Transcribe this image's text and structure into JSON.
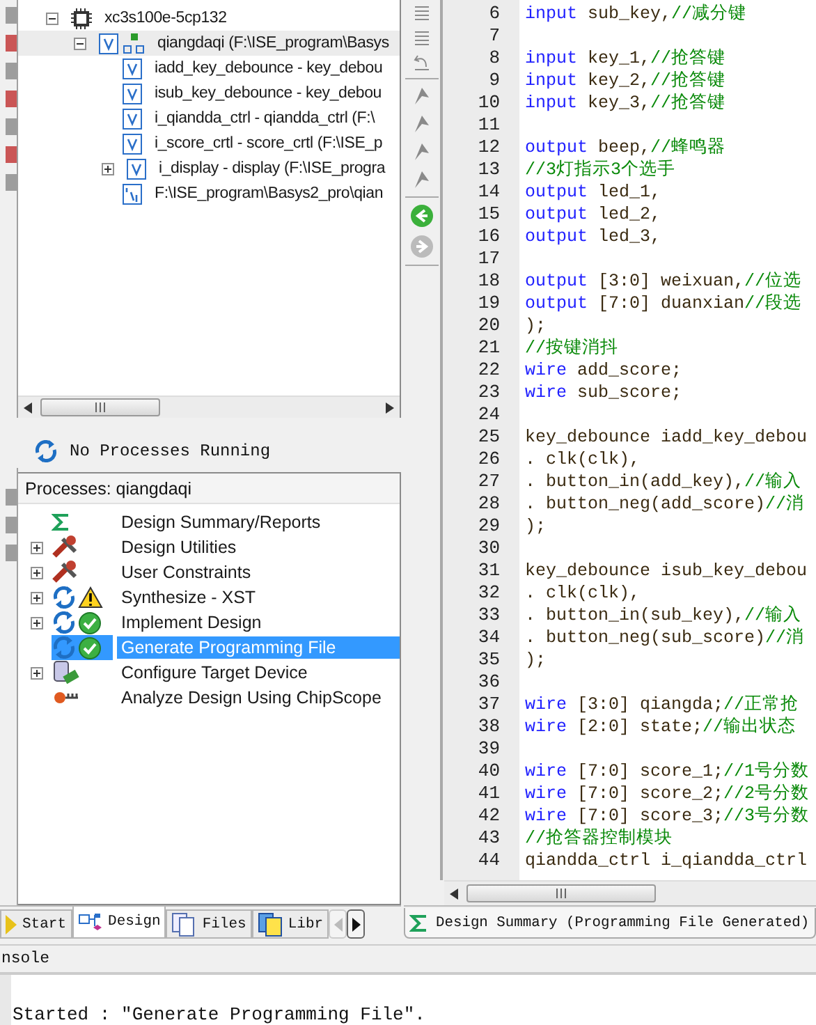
{
  "hierarchy": {
    "items": [
      {
        "label": "xc3s100e-5cp132",
        "kind": "chip",
        "expandable": true,
        "expanded": true,
        "selected": false,
        "children": [
          {
            "label": "qiangdaqi (F:\\ISE_program\\Basys",
            "kind": "top",
            "expandable": true,
            "expanded": true,
            "selected": true,
            "children": [
              {
                "label": "iadd_key_debounce - key_debou",
                "kind": "verilog",
                "expandable": false,
                "selected": false
              },
              {
                "label": "isub_key_debounce - key_debou",
                "kind": "verilog",
                "expandable": false,
                "selected": false
              },
              {
                "label": "i_qiandda_ctrl - qiandda_ctrl (F:\\",
                "kind": "verilog",
                "expandable": false,
                "selected": false
              },
              {
                "label": "i_score_crtl - score_crtl (F:\\ISE_p",
                "kind": "verilog",
                "expandable": false,
                "selected": false
              },
              {
                "label": "i_display - display (F:\\ISE_progra",
                "kind": "verilog",
                "expandable": true,
                "expanded": false,
                "selected": false
              },
              {
                "label": "F:\\ISE_program\\Basys2_pro\\qian",
                "kind": "ucf",
                "expandable": false,
                "selected": false
              }
            ]
          }
        ]
      }
    ]
  },
  "process_status": "No Processes Running",
  "processes": {
    "title": "Processes: qiangdaqi",
    "items": [
      {
        "label": "Design Summary/Reports",
        "kind": "summary",
        "warning": false,
        "completed": false,
        "expandable": false,
        "selected": false
      },
      {
        "label": "Design Utilities",
        "kind": "tools",
        "warning": false,
        "completed": false,
        "expandable": true,
        "selected": false
      },
      {
        "label": "User Constraints",
        "kind": "tools",
        "warning": false,
        "completed": false,
        "expandable": true,
        "selected": false
      },
      {
        "label": "Synthesize - XST",
        "kind": "run",
        "warning": true,
        "completed": false,
        "expandable": true,
        "selected": false
      },
      {
        "label": "Implement Design",
        "kind": "run",
        "warning": false,
        "completed": true,
        "expandable": true,
        "selected": false
      },
      {
        "label": "Generate Programming File",
        "kind": "run",
        "warning": false,
        "completed": true,
        "expandable": false,
        "selected": true
      },
      {
        "label": "Configure Target Device",
        "kind": "device",
        "warning": false,
        "completed": false,
        "expandable": true,
        "selected": false
      },
      {
        "label": "Analyze Design Using ChipScope",
        "kind": "probe",
        "warning": false,
        "completed": false,
        "expandable": false,
        "selected": false
      }
    ]
  },
  "panel_tabs": [
    {
      "label": "Start",
      "kind": "start",
      "selected": false
    },
    {
      "label": "Design",
      "kind": "design",
      "selected": true
    },
    {
      "label": "Files",
      "kind": "files",
      "selected": false
    },
    {
      "label": "Libr",
      "kind": "libraries",
      "selected": false
    }
  ],
  "tab_scroll": [
    {
      "kind": "left",
      "disabled": true
    },
    {
      "kind": "right",
      "disabled": false
    }
  ],
  "editor": {
    "lines": [
      {
        "number": "6",
        "tokens": [
          {
            "kind": "keyword",
            "text": "input"
          },
          {
            "kind": "plain",
            "text": " sub_key,"
          },
          {
            "kind": "comment",
            "text": "//减分键"
          }
        ]
      },
      {
        "number": "7"
      },
      {
        "number": "8",
        "tokens": [
          {
            "kind": "keyword",
            "text": "input"
          },
          {
            "kind": "plain",
            "text": " key_1,"
          },
          {
            "kind": "comment",
            "text": "//抢答键"
          }
        ]
      },
      {
        "number": "9",
        "tokens": [
          {
            "kind": "keyword",
            "text": "input"
          },
          {
            "kind": "plain",
            "text": " key_2,"
          },
          {
            "kind": "comment",
            "text": "//抢答键"
          }
        ]
      },
      {
        "number": "10",
        "tokens": [
          {
            "kind": "keyword",
            "text": "input"
          },
          {
            "kind": "plain",
            "text": " key_3,"
          },
          {
            "kind": "comment",
            "text": "//抢答键"
          }
        ]
      },
      {
        "number": "11"
      },
      {
        "number": "12",
        "tokens": [
          {
            "kind": "keyword",
            "text": "output"
          },
          {
            "kind": "plain",
            "text": " beep,"
          },
          {
            "kind": "comment",
            "text": "//蜂鸣器"
          }
        ]
      },
      {
        "number": "13",
        "tokens": [
          {
            "kind": "comment",
            "text": "//3灯指示3个选手"
          }
        ]
      },
      {
        "number": "14",
        "tokens": [
          {
            "kind": "keyword",
            "text": "output"
          },
          {
            "kind": "plain",
            "text": " led_1,"
          }
        ]
      },
      {
        "number": "15",
        "tokens": [
          {
            "kind": "keyword",
            "text": "output"
          },
          {
            "kind": "plain",
            "text": " led_2,"
          }
        ]
      },
      {
        "number": "16",
        "tokens": [
          {
            "kind": "keyword",
            "text": "output"
          },
          {
            "kind": "plain",
            "text": " led_3,"
          }
        ]
      },
      {
        "number": "17"
      },
      {
        "number": "18",
        "tokens": [
          {
            "kind": "keyword",
            "text": "output"
          },
          {
            "kind": "plain",
            "text": " [3:0] weixuan,"
          },
          {
            "kind": "comment",
            "text": "//位选"
          }
        ]
      },
      {
        "number": "19",
        "tokens": [
          {
            "kind": "keyword",
            "text": "output"
          },
          {
            "kind": "plain",
            "text": " [7:0] duanxian"
          },
          {
            "kind": "comment",
            "text": "//段选"
          }
        ]
      },
      {
        "number": "20",
        "tokens": [
          {
            "kind": "plain",
            "text": ");"
          }
        ]
      },
      {
        "number": "21",
        "tokens": [
          {
            "kind": "comment",
            "text": "//按键消抖"
          }
        ]
      },
      {
        "number": "22",
        "tokens": [
          {
            "kind": "keyword",
            "text": "wire"
          },
          {
            "kind": "plain",
            "text": " add_score;"
          }
        ]
      },
      {
        "number": "23",
        "tokens": [
          {
            "kind": "keyword",
            "text": "wire"
          },
          {
            "kind": "plain",
            "text": " sub_score;"
          }
        ]
      },
      {
        "number": "24"
      },
      {
        "number": "25",
        "tokens": [
          {
            "kind": "plain",
            "text": "key_debounce iadd_key_debou"
          }
        ]
      },
      {
        "number": "26",
        "tokens": [
          {
            "kind": "plain",
            "text": ". clk(clk),"
          }
        ]
      },
      {
        "number": "27",
        "tokens": [
          {
            "kind": "plain",
            "text": ". button_in(add_key),"
          },
          {
            "kind": "comment",
            "text": "//输入"
          }
        ]
      },
      {
        "number": "28",
        "tokens": [
          {
            "kind": "plain",
            "text": ". button_neg(add_score)"
          },
          {
            "kind": "comment",
            "text": "//消"
          }
        ]
      },
      {
        "number": "29",
        "tokens": [
          {
            "kind": "plain",
            "text": ");"
          }
        ]
      },
      {
        "number": "30"
      },
      {
        "number": "31",
        "tokens": [
          {
            "kind": "plain",
            "text": "key_debounce isub_key_debou"
          }
        ]
      },
      {
        "number": "32",
        "tokens": [
          {
            "kind": "plain",
            "text": ". clk(clk),"
          }
        ]
      },
      {
        "number": "33",
        "tokens": [
          {
            "kind": "plain",
            "text": ". button_in(sub_key),"
          },
          {
            "kind": "comment",
            "text": "//输入"
          }
        ]
      },
      {
        "number": "34",
        "tokens": [
          {
            "kind": "plain",
            "text": ". button_neg(sub_score)"
          },
          {
            "kind": "comment",
            "text": "//消"
          }
        ]
      },
      {
        "number": "35",
        "tokens": [
          {
            "kind": "plain",
            "text": ");"
          }
        ]
      },
      {
        "number": "36"
      },
      {
        "number": "37",
        "tokens": [
          {
            "kind": "keyword",
            "text": "wire"
          },
          {
            "kind": "plain",
            "text": " [3:0] qiangda;"
          },
          {
            "kind": "comment",
            "text": "//正常抢"
          }
        ]
      },
      {
        "number": "38",
        "tokens": [
          {
            "kind": "keyword",
            "text": "wire"
          },
          {
            "kind": "plain",
            "text": " [2:0] state;"
          },
          {
            "kind": "comment",
            "text": "//输出状态"
          }
        ]
      },
      {
        "number": "39"
      },
      {
        "number": "40",
        "tokens": [
          {
            "kind": "keyword",
            "text": "wire"
          },
          {
            "kind": "plain",
            "text": " [7:0] score_1;"
          },
          {
            "kind": "comment",
            "text": "//1号分数"
          }
        ]
      },
      {
        "number": "41",
        "tokens": [
          {
            "kind": "keyword",
            "text": "wire"
          },
          {
            "kind": "plain",
            "text": " [7:0] score_2;"
          },
          {
            "kind": "comment",
            "text": "//2号分数"
          }
        ]
      },
      {
        "number": "42",
        "tokens": [
          {
            "kind": "keyword",
            "text": "wire"
          },
          {
            "kind": "plain",
            "text": " [7:0] score_3;"
          },
          {
            "kind": "comment",
            "text": "//3号分数"
          }
        ]
      },
      {
        "number": "43",
        "tokens": [
          {
            "kind": "comment",
            "text": "//抢答器控制模块"
          }
        ]
      },
      {
        "number": "44",
        "tokens": [
          {
            "kind": "plain",
            "text": "qiandda_ctrl i_qiandda_ctrl"
          }
        ]
      }
    ]
  },
  "editor_tab": {
    "label": "Design Summary (Programming File Generated)"
  },
  "console": {
    "title": "nsole",
    "lines": [
      "Started : \"Generate Programming File\"."
    ]
  }
}
